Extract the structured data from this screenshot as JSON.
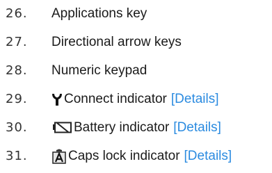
{
  "items": [
    {
      "num": "26.",
      "label": "Applications key"
    },
    {
      "num": "27.",
      "label": "Directional arrow keys"
    },
    {
      "num": "28.",
      "label": "Numeric keypad"
    },
    {
      "num": "29.",
      "label": "Connect indicator",
      "link": "[Details]",
      "icon": "antenna-icon"
    },
    {
      "num": "30.",
      "label": "Battery indicator",
      "link": "[Details]",
      "icon": "battery-icon"
    },
    {
      "num": "31.",
      "label": "Caps lock indicator",
      "link": "[Details]",
      "icon": "caps-lock-icon"
    }
  ],
  "colors": {
    "text": "#1a1a1a",
    "link": "#2b8be0"
  }
}
